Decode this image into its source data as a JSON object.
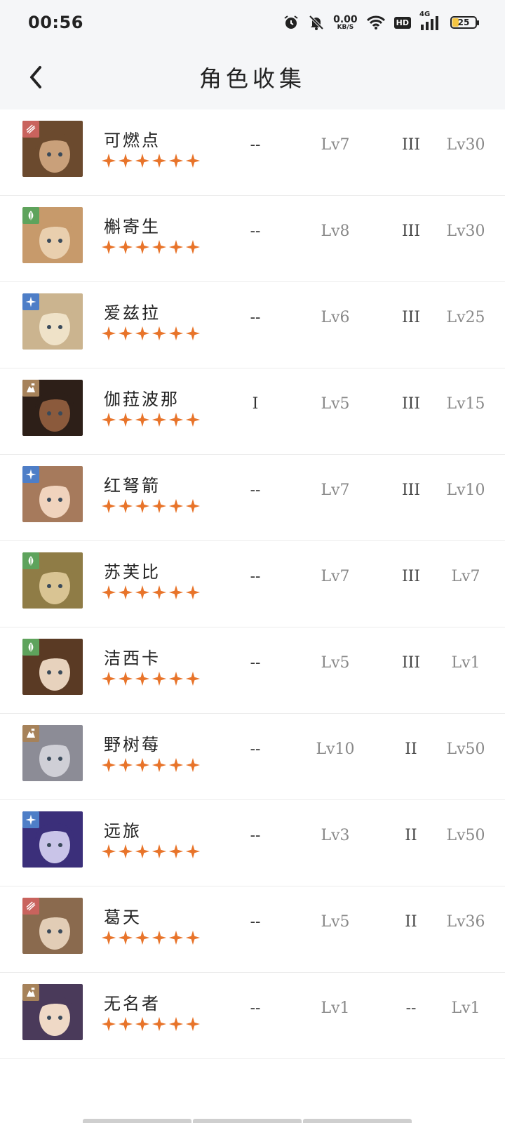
{
  "status_bar": {
    "time": "00:56",
    "net_speed_value": "0.00",
    "net_speed_unit": "KB/S",
    "hd_label": "HD",
    "network_label": "4G",
    "battery_level": "25",
    "icons": [
      "alarm-icon",
      "mute-bell-icon",
      "wifi-icon",
      "signal-icon",
      "battery-icon"
    ]
  },
  "header": {
    "title": "角色收集",
    "back_icon": "chevron-left-icon"
  },
  "colors": {
    "star": "#e8742a",
    "element_fire": "#c9635d",
    "element_leaf": "#5ea35c",
    "element_star": "#4e7ec7",
    "element_rock": "#a6825a"
  },
  "characters": [
    {
      "name": "可燃点",
      "element": "fire",
      "stars": 6,
      "c1": "--",
      "c2": "Lv7",
      "c3": "III",
      "c4": "Lv30"
    },
    {
      "name": "槲寄生",
      "element": "leaf",
      "stars": 6,
      "c1": "--",
      "c2": "Lv8",
      "c3": "III",
      "c4": "Lv30"
    },
    {
      "name": "爱兹拉",
      "element": "star",
      "stars": 6,
      "c1": "--",
      "c2": "Lv6",
      "c3": "III",
      "c4": "Lv25"
    },
    {
      "name": "伽菈波那",
      "element": "rock",
      "stars": 6,
      "c1": "I",
      "c2": "Lv5",
      "c3": "III",
      "c4": "Lv15"
    },
    {
      "name": "红弩箭",
      "element": "star",
      "stars": 6,
      "c1": "--",
      "c2": "Lv7",
      "c3": "III",
      "c4": "Lv10"
    },
    {
      "name": "苏芙比",
      "element": "leaf",
      "stars": 6,
      "c1": "--",
      "c2": "Lv7",
      "c3": "III",
      "c4": "Lv7"
    },
    {
      "name": "洁西卡",
      "element": "leaf",
      "stars": 6,
      "c1": "--",
      "c2": "Lv5",
      "c3": "III",
      "c4": "Lv1"
    },
    {
      "name": "野树莓",
      "element": "rock",
      "stars": 6,
      "c1": "--",
      "c2": "Lv10",
      "c3": "II",
      "c4": "Lv50"
    },
    {
      "name": "远旅",
      "element": "star",
      "stars": 6,
      "c1": "--",
      "c2": "Lv3",
      "c3": "II",
      "c4": "Lv50"
    },
    {
      "name": "葛天",
      "element": "fire",
      "stars": 6,
      "c1": "--",
      "c2": "Lv5",
      "c3": "II",
      "c4": "Lv36"
    },
    {
      "name": "无名者",
      "element": "rock",
      "stars": 6,
      "c1": "--",
      "c2": "Lv1",
      "c3": "--",
      "c4": "Lv1"
    }
  ]
}
